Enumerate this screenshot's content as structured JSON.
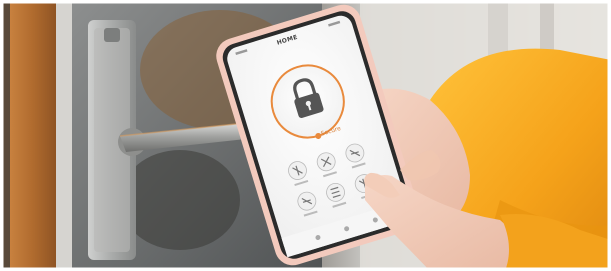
{
  "phone_app": {
    "title": "HOME",
    "lock_status": "Secure",
    "lock_icon": "padlock-icon",
    "accent_color": "#e98a3c"
  },
  "scene_colors": {
    "jacket": "#f5a623",
    "phone_case": "#f4c9c0",
    "door_frame": "#b8743c",
    "door_glass": "#6b7277",
    "handle": "#a8a8a8"
  }
}
